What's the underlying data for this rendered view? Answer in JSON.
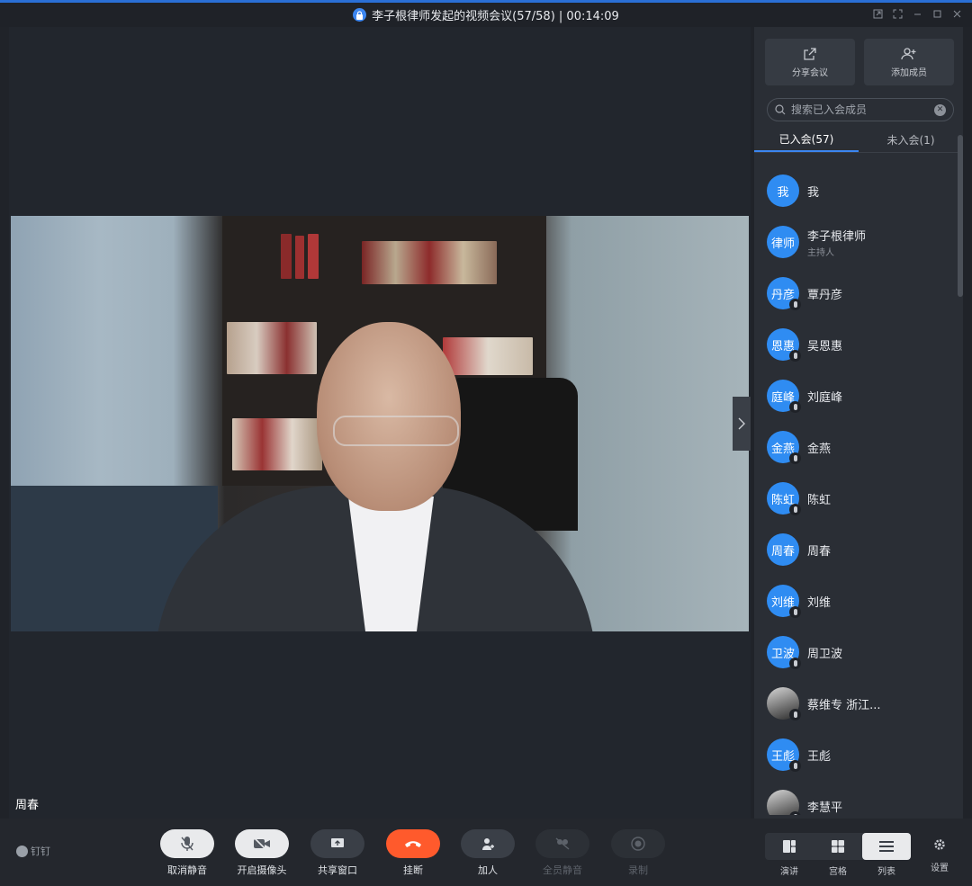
{
  "window": {
    "title": "李子根律师发起的视频会议(57/58) | 00:14:09"
  },
  "stage": {
    "speaker_name": "周春"
  },
  "sidebar": {
    "share_label": "分享会议",
    "add_member_label": "添加成员",
    "search_placeholder": "搜索已入会成员",
    "tabs": [
      {
        "label": "已入会(57)",
        "active": true
      },
      {
        "label": "未入会(1)",
        "active": false
      }
    ],
    "members": [
      {
        "avatar": "我",
        "name": "我",
        "role": "",
        "photo": false
      },
      {
        "avatar": "律师",
        "name": "李子根律师",
        "role": "主持人",
        "photo": false
      },
      {
        "avatar": "丹彦",
        "name": "覃丹彦",
        "role": "",
        "photo": false
      },
      {
        "avatar": "恩惠",
        "name": "吴恩惠",
        "role": "",
        "photo": false
      },
      {
        "avatar": "庭峰",
        "name": "刘庭峰",
        "role": "",
        "photo": false
      },
      {
        "avatar": "金燕",
        "name": "金燕",
        "role": "",
        "photo": false
      },
      {
        "avatar": "陈虹",
        "name": "陈虹",
        "role": "",
        "photo": false
      },
      {
        "avatar": "周春",
        "name": "周春",
        "role": "",
        "photo": false
      },
      {
        "avatar": "刘维",
        "name": "刘维",
        "role": "",
        "photo": false
      },
      {
        "avatar": "卫波",
        "name": "周卫波",
        "role": "",
        "photo": false
      },
      {
        "avatar": "",
        "name": "蔡维专 浙江...",
        "role": "",
        "photo": true
      },
      {
        "avatar": "王彪",
        "name": "王彪",
        "role": "",
        "photo": false
      },
      {
        "avatar": "",
        "name": "李慧平",
        "role": "",
        "photo": true
      }
    ]
  },
  "toolbar": {
    "brand": "钉钉",
    "unmute_label": "取消静音",
    "camera_label": "开启摄像头",
    "share_window_label": "共享窗口",
    "hangup_label": "挂断",
    "add_person_label": "加人",
    "mute_all_label": "全员静音",
    "record_label": "录制",
    "view_speaker_label": "演讲",
    "view_grid_label": "宫格",
    "view_list_label": "列表",
    "settings_label": "设置"
  },
  "colors": {
    "accent": "#2f8cf2",
    "hangup": "#ff5a2c",
    "background": "#202329"
  }
}
